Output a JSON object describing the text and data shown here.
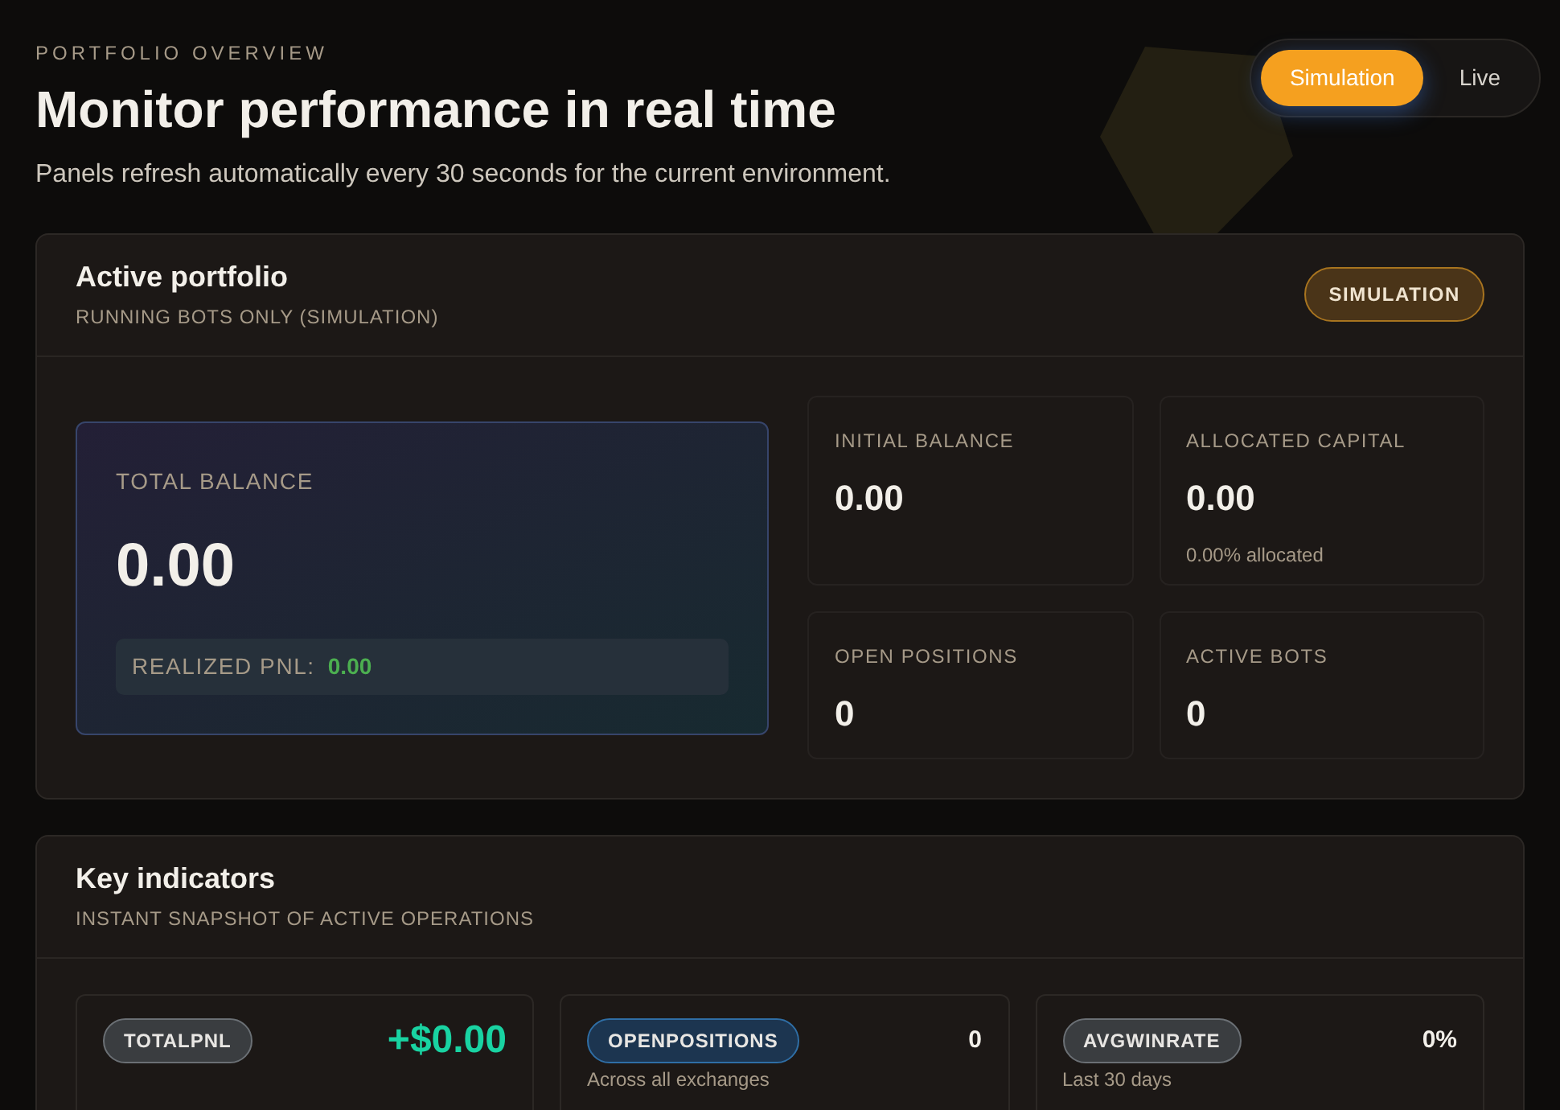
{
  "header": {
    "eyebrow": "PORTFOLIO OVERVIEW",
    "title": "Monitor performance in real time",
    "subtitle": "Panels refresh automatically every 30 seconds for the current environment."
  },
  "environment_toggle": [
    {
      "label": "Simulation",
      "selected": true
    },
    {
      "label": "Live",
      "selected": false
    }
  ],
  "active_portfolio": {
    "title": "Active portfolio",
    "subtitle": "RUNNING BOTS ONLY (SIMULATION)",
    "badge": "SIMULATION",
    "total_balance": {
      "label": "TOTAL BALANCE",
      "value": "0.00",
      "realized_label": "REALIZED PNL:",
      "realized_value": "0.00"
    },
    "stats": [
      {
        "label": "INITIAL BALANCE",
        "value": "0.00"
      },
      {
        "label": "ALLOCATED CAPITAL",
        "value": "0.00",
        "note": "0.00% allocated"
      },
      {
        "label": "OPEN POSITIONS",
        "value": "0"
      },
      {
        "label": "ACTIVE BOTS",
        "value": "0"
      }
    ]
  },
  "key_indicators": {
    "title": "Key indicators",
    "subtitle": "INSTANT SNAPSHOT OF ACTIVE OPERATIONS",
    "items": [
      {
        "kind": "pnl",
        "badge": "TOTALPNL",
        "value": "+$0.00"
      },
      {
        "kind": "count",
        "badge": "OPENPOSITIONS",
        "value": "0",
        "note": "Across all exchanges"
      },
      {
        "kind": "rate",
        "badge": "AVGWINRATE",
        "value": "0%",
        "note": "Last 30 days"
      }
    ]
  }
}
